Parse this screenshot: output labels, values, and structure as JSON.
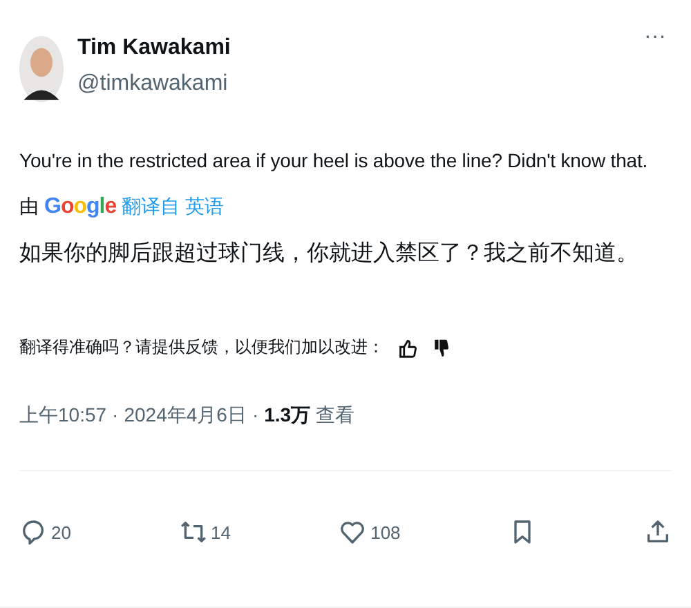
{
  "author": {
    "name": "Tim Kawakami",
    "handle": "@timkawakami",
    "more": "···"
  },
  "tweet": {
    "text": "You're in the restricted area if your heel is above the line? Didn't know that.",
    "translated_by": "由",
    "translator": "Google",
    "translated_from": "翻译自 英语",
    "translation": "如果你的脚后跟超过球门线，你就进入禁区了？我之前不知道。"
  },
  "feedback": {
    "prompt": "翻译得准确吗？请提供反馈，以便我们加以改进："
  },
  "meta": {
    "time": "上午10:57",
    "separator": "·",
    "date": "2024年4月6日",
    "separator_2": "·",
    "views": "1.3万",
    "views_label": "查看"
  },
  "actions": [
    {
      "kind": "reply",
      "count": "20"
    },
    {
      "kind": "retweet",
      "count": "14"
    },
    {
      "kind": "like",
      "count": "108"
    },
    {
      "kind": "bookmark"
    },
    {
      "kind": "share"
    }
  ]
}
